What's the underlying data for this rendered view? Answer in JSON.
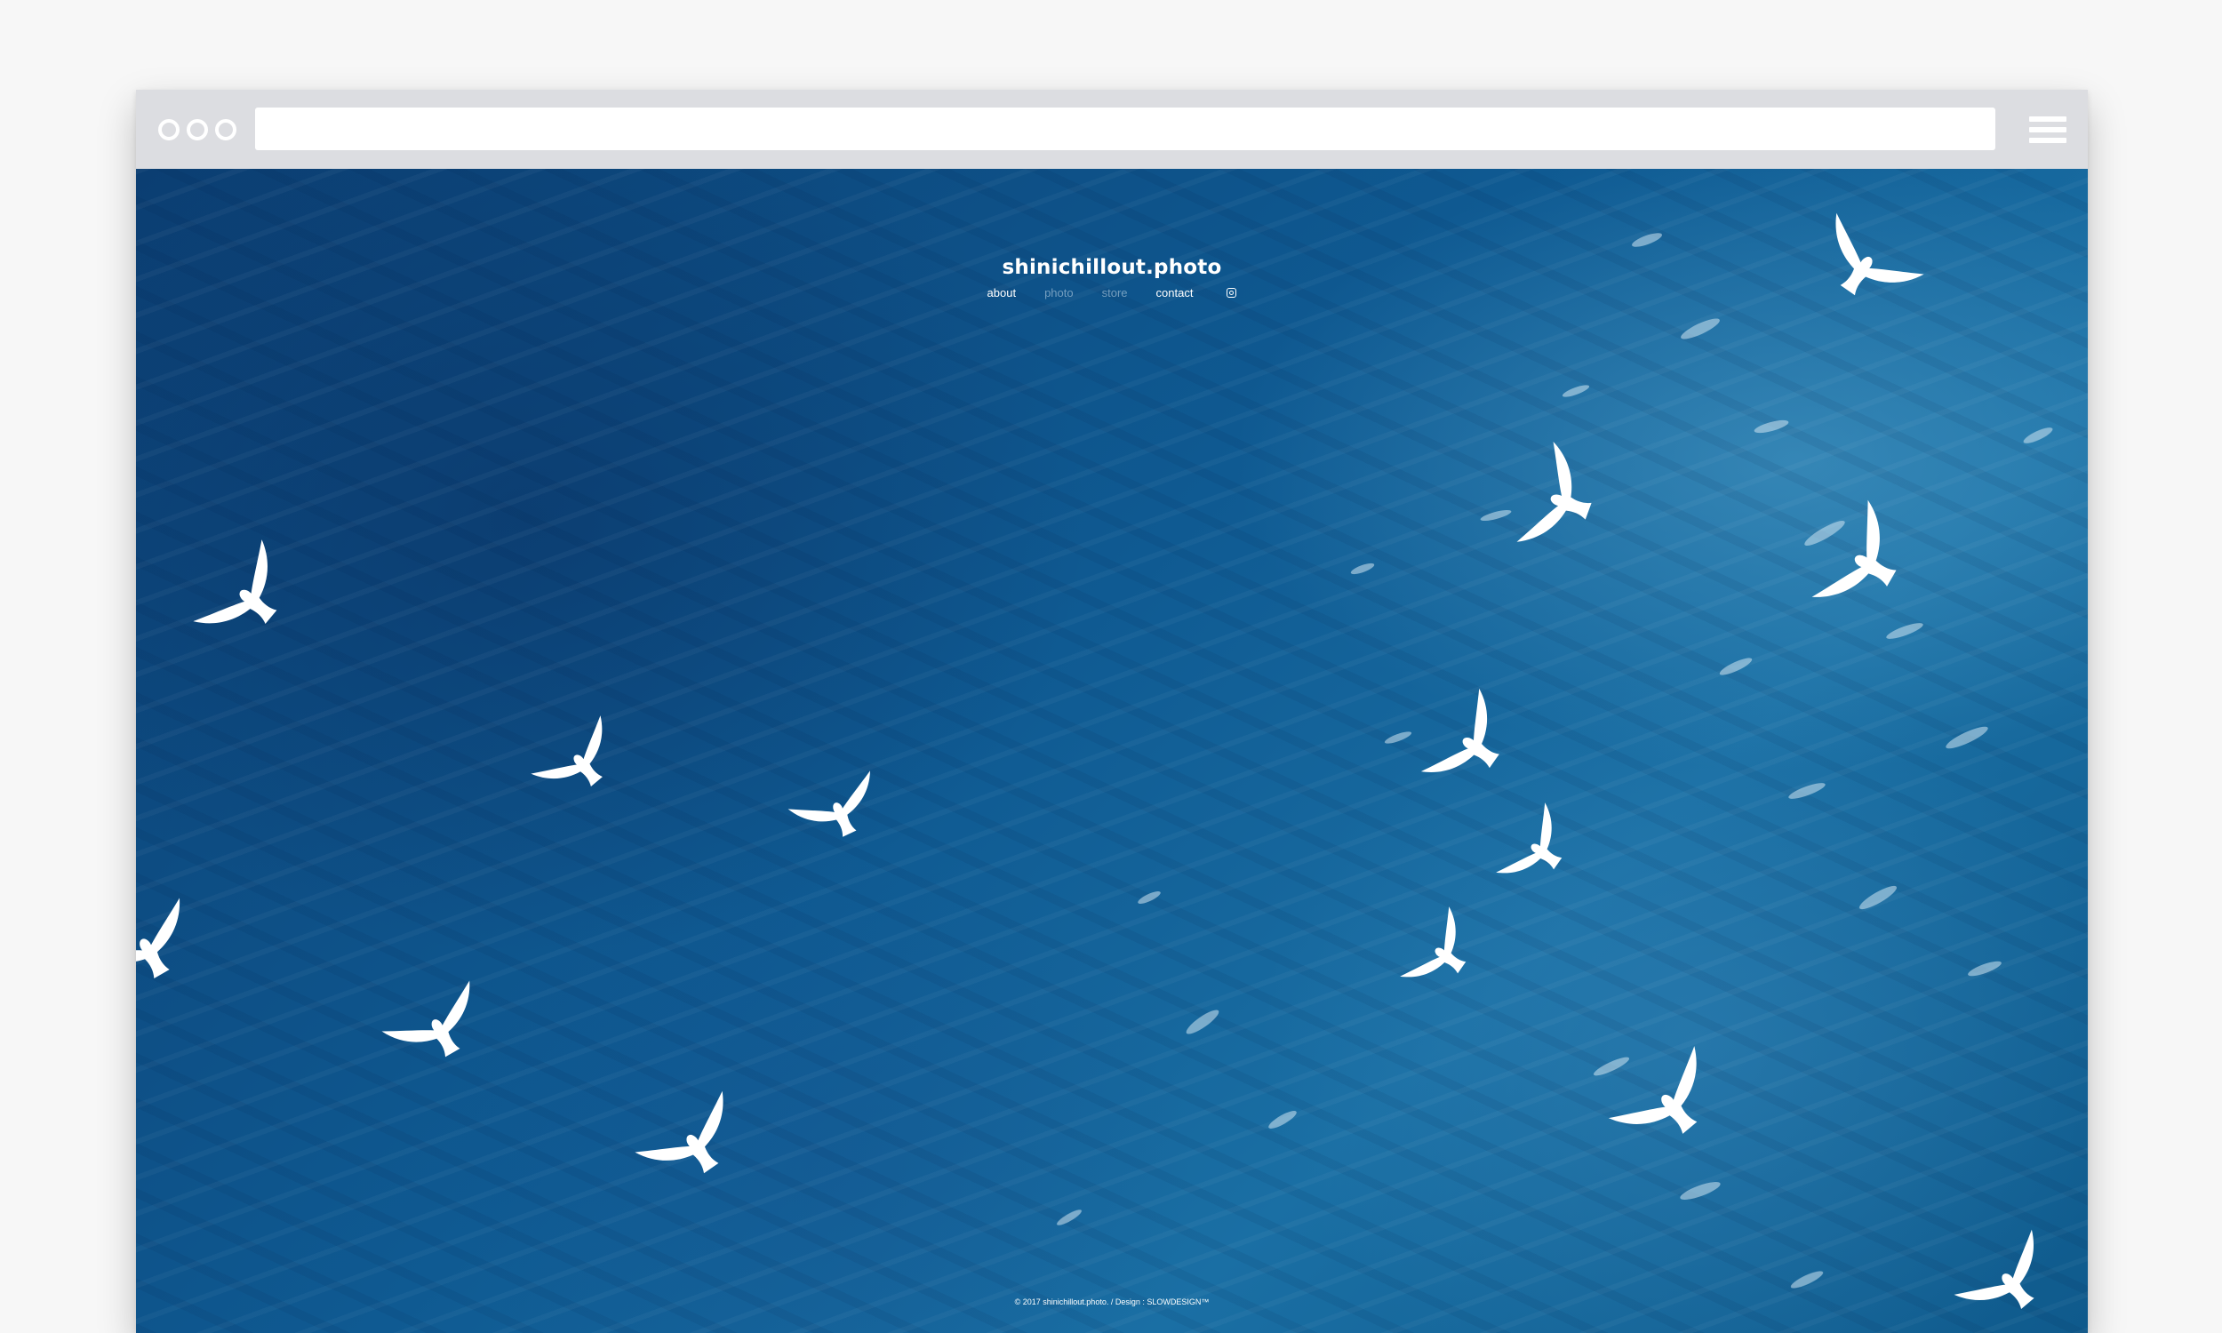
{
  "browser": {
    "address_bar": ""
  },
  "site": {
    "title": "shinichillout.photo",
    "nav": [
      {
        "label": "about",
        "active": true
      },
      {
        "label": "photo",
        "active": false
      },
      {
        "label": "store",
        "active": false
      },
      {
        "label": "contact",
        "active": true
      }
    ],
    "instagram_icon": "instagram-icon",
    "footer": "© 2017 shinichillout.photo. / Design : SLOWDESIGN™"
  },
  "hero": {
    "subject": "seagulls over ocean",
    "ocean_color": "#0f5a92",
    "bird_color": "#ffffff"
  }
}
